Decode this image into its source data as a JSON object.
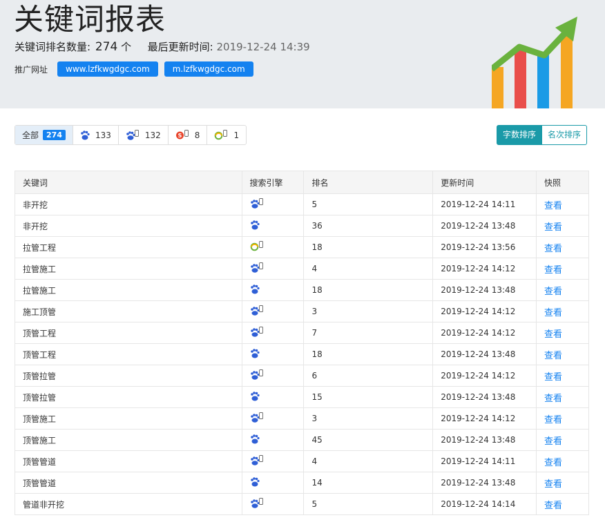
{
  "header": {
    "title": "关键词报表",
    "count_label": "关键词排名数量:",
    "count_value": "274",
    "count_unit": "个",
    "updated_label": "最后更新时间:",
    "updated_value": "2019-12-24 14:39",
    "promo_label": "推广网址",
    "urls": [
      "www.lzfkwgdgc.com",
      "m.lzfkwgdgc.com"
    ]
  },
  "filters": [
    {
      "label": "全部",
      "count": "274",
      "icon": "all"
    },
    {
      "label": "",
      "count": "133",
      "icon": "baidu-pc-icon"
    },
    {
      "label": "",
      "count": "132",
      "icon": "baidu-mobile-icon"
    },
    {
      "label": "",
      "count": "8",
      "icon": "sogou-mobile-icon"
    },
    {
      "label": "",
      "count": "1",
      "icon": "360-mobile-icon"
    }
  ],
  "sort": {
    "by_length": "字数排序",
    "by_rank": "名次排序"
  },
  "table": {
    "headers": [
      "关键词",
      "搜索引擎",
      "排名",
      "更新时间",
      "快照"
    ],
    "rows": [
      {
        "keyword": "非开挖",
        "engine": "baidu-mobile-icon",
        "rank": "5",
        "time": "2019-12-24 14:11",
        "link": "查看"
      },
      {
        "keyword": "非开挖",
        "engine": "baidu-pc-icon",
        "rank": "36",
        "time": "2019-12-24 13:48",
        "link": "查看"
      },
      {
        "keyword": "拉管工程",
        "engine": "360-mobile-icon",
        "rank": "18",
        "time": "2019-12-24 13:56",
        "link": "查看"
      },
      {
        "keyword": "拉管施工",
        "engine": "baidu-mobile-icon",
        "rank": "4",
        "time": "2019-12-24 14:12",
        "link": "查看"
      },
      {
        "keyword": "拉管施工",
        "engine": "baidu-pc-icon",
        "rank": "18",
        "time": "2019-12-24 13:48",
        "link": "查看"
      },
      {
        "keyword": "施工顶管",
        "engine": "baidu-mobile-icon",
        "rank": "3",
        "time": "2019-12-24 14:12",
        "link": "查看"
      },
      {
        "keyword": "顶管工程",
        "engine": "baidu-mobile-icon",
        "rank": "7",
        "time": "2019-12-24 14:12",
        "link": "查看"
      },
      {
        "keyword": "顶管工程",
        "engine": "baidu-pc-icon",
        "rank": "18",
        "time": "2019-12-24 13:48",
        "link": "查看"
      },
      {
        "keyword": "顶管拉管",
        "engine": "baidu-mobile-icon",
        "rank": "6",
        "time": "2019-12-24 14:12",
        "link": "查看"
      },
      {
        "keyword": "顶管拉管",
        "engine": "baidu-pc-icon",
        "rank": "15",
        "time": "2019-12-24 13:48",
        "link": "查看"
      },
      {
        "keyword": "顶管施工",
        "engine": "baidu-mobile-icon",
        "rank": "3",
        "time": "2019-12-24 14:12",
        "link": "查看"
      },
      {
        "keyword": "顶管施工",
        "engine": "baidu-pc-icon",
        "rank": "45",
        "time": "2019-12-24 13:48",
        "link": "查看"
      },
      {
        "keyword": "顶管管道",
        "engine": "baidu-mobile-icon",
        "rank": "4",
        "time": "2019-12-24 14:11",
        "link": "查看"
      },
      {
        "keyword": "顶管管道",
        "engine": "baidu-pc-icon",
        "rank": "14",
        "time": "2019-12-24 13:48",
        "link": "查看"
      },
      {
        "keyword": "管道非开挖",
        "engine": "baidu-mobile-icon",
        "rank": "5",
        "time": "2019-12-24 14:14",
        "link": "查看"
      }
    ]
  },
  "colors": {
    "accent": "#1482f0",
    "teal": "#1a9aa8",
    "header_bg": "#e9ecef",
    "bar_orange": "#f5a623",
    "bar_red": "#e94e4b",
    "bar_blue": "#1a9be6",
    "arrow_green": "#6ab23e"
  }
}
